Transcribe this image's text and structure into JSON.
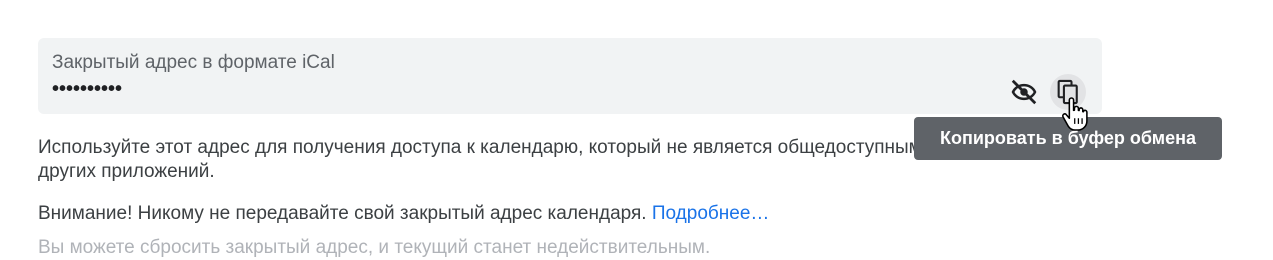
{
  "ical_field": {
    "label": "Закрытый адрес в формате iCal",
    "value_masked": "••••••••••"
  },
  "icons": {
    "visibility_toggle": "eye-off-icon",
    "copy": "copy-icon"
  },
  "tooltip": {
    "text": "Копировать в буфер обмена"
  },
  "description": {
    "line1": "Используйте этот адрес для получения доступа к календарю, который не является общедоступным, из",
    "line2": "других приложений."
  },
  "warning": {
    "text": "Внимание! Никому не передавайте свой закрытый адрес календаря.",
    "link_label": "Подробнее…"
  },
  "reset_text": "Вы можете сбросить закрытый адрес, и текущий станет недействительным.",
  "colors": {
    "field_bg": "#f1f3f4",
    "link": "#1a73e8",
    "tooltip_bg": "#5f6368"
  }
}
